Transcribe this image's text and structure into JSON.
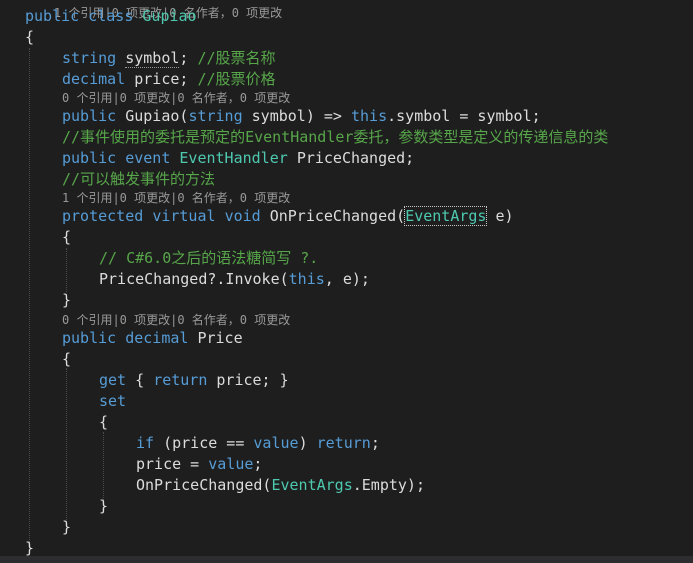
{
  "editor": {
    "top_lens": "1 个引用|0 项更改|0 名作者，0 项更改",
    "l_class_kw1": "public",
    "l_class_kw2": "class",
    "l_class_name": "Gupiao",
    "brace_open": "{",
    "brace_close": "}",
    "l_symbol_type": "string",
    "l_symbol_name": "symbol",
    "l_symbol_semi": ";",
    "l_symbol_comment": "//股票名称",
    "l_price_type": "decimal",
    "l_price_name": "price;",
    "l_price_comment": "//股票价格",
    "lens_ctor": "0 个引用|0 项更改|0 名作者，0 项更改",
    "l_ctor_kw": "public",
    "l_ctor_name": "Gupiao(",
    "l_ctor_ptype": "string",
    "l_ctor_rest1": "symbol) =>",
    "l_ctor_this": "this",
    "l_ctor_rest2": ".symbol = symbol;",
    "comment_delegate": "//事件使用的委托是预定的EventHandler委托，参数类型是定义的传递信息的类",
    "l_event_kw1": "public",
    "l_event_kw2": "event",
    "l_event_type": "EventHandler",
    "l_event_name": "PriceChanged;",
    "comment_method": "//可以触发事件的方法",
    "lens_method": "1 个引用|0 项更改|0 名作者，0 项更改",
    "l_method_kw1": "protected",
    "l_method_kw2": "virtual",
    "l_method_kw3": "void",
    "l_method_name": "OnPriceChanged(",
    "l_method_ptype": "EventArgs",
    "l_method_rest": "e)",
    "comment_csharp6": "// C#6.0之后的语法糖简写 ?.",
    "l_invoke_1": "PriceChanged?.Invoke(",
    "l_invoke_this": "this",
    "l_invoke_2": ", e);",
    "lens_prop": "0 个引用|0 项更改|0 名作者，0 项更改",
    "l_prop_kw1": "public",
    "l_prop_kw2": "decimal",
    "l_prop_name": "Price",
    "l_get_kw": "get",
    "l_get_b1": "{",
    "l_get_ret": "return",
    "l_get_rest": "price; }",
    "l_set_kw": "set",
    "l_if_kw": "if",
    "l_if_1": "(price ==",
    "l_if_value": "value",
    "l_if_2": ")",
    "l_if_ret": "return",
    "l_if_3": ";",
    "l_assign_1": "price =",
    "l_assign_value": "value",
    "l_assign_2": ";",
    "l_call_1": "OnPriceChanged(",
    "l_call_type": "EventArgs",
    "l_call_2": ".Empty);"
  },
  "colors": {
    "background": "#1e1e1e",
    "keyword": "#569cd6",
    "comment": "#57a64a",
    "type": "#4ec9b0",
    "text": "#dcdcdc",
    "control": "#d8a0df",
    "codelens": "#999999"
  }
}
